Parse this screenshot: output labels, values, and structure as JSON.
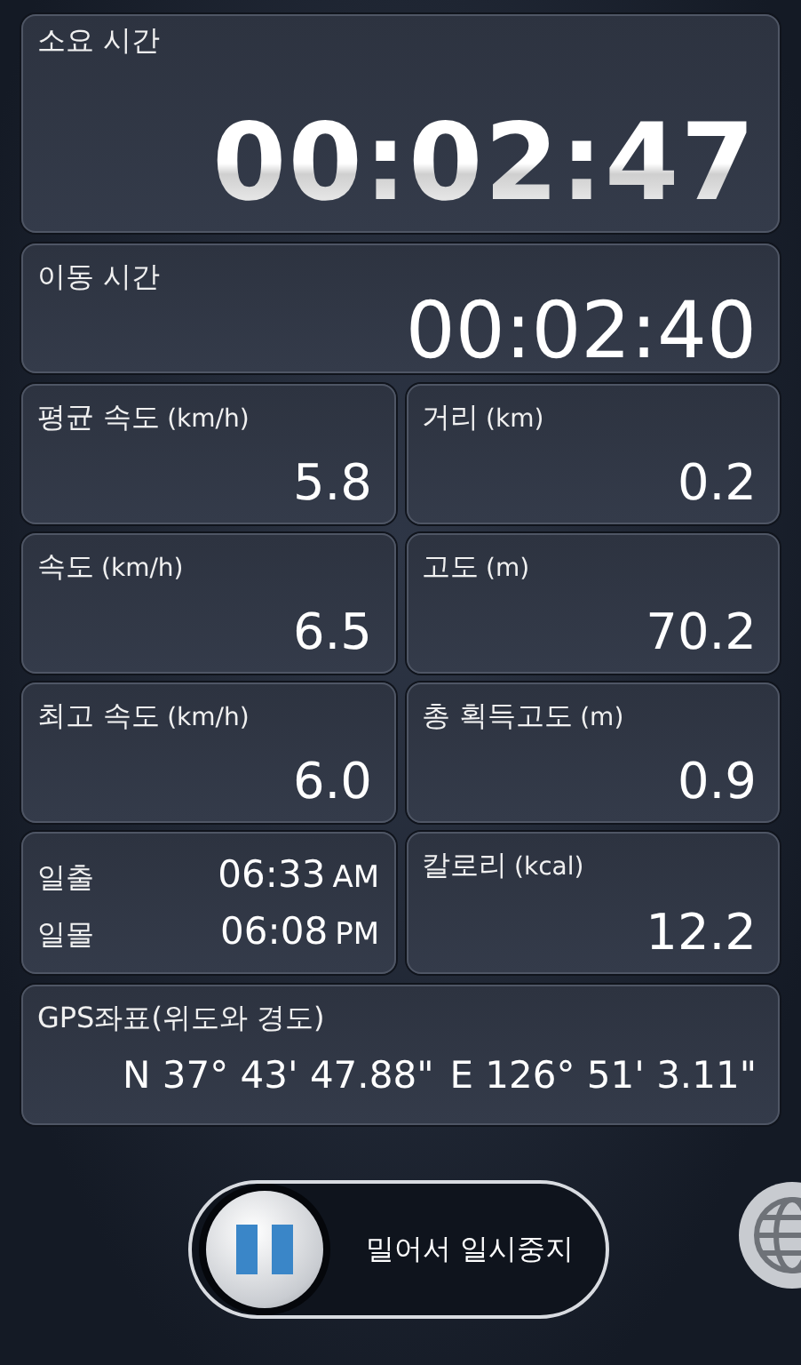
{
  "elapsed": {
    "label": "소요 시간",
    "value": "00:02:47"
  },
  "moving": {
    "label": "이동 시간",
    "value": "00:02:40"
  },
  "tiles": [
    {
      "kind": "stat",
      "label": "평균 속도",
      "unit": "(km/h)",
      "value": "5.8"
    },
    {
      "kind": "stat",
      "label": "거리",
      "unit": "(km)",
      "value": "0.2"
    },
    {
      "kind": "stat",
      "label": "속도",
      "unit": "(km/h)",
      "value": "6.5"
    },
    {
      "kind": "stat",
      "label": "고도",
      "unit": "(m)",
      "value": "70.2"
    },
    {
      "kind": "stat",
      "label": "최고 속도",
      "unit": "(km/h)",
      "value": "6.0"
    },
    {
      "kind": "stat",
      "label": "총 획득고도",
      "unit": "(m)",
      "value": "0.9"
    },
    {
      "kind": "sun",
      "rows": [
        {
          "label": "일출",
          "time": "06:33",
          "period": "AM"
        },
        {
          "label": "일몰",
          "time": "06:08",
          "period": "PM"
        }
      ]
    },
    {
      "kind": "stat",
      "label": "칼로리",
      "unit": "(kcal)",
      "value": "12.2"
    }
  ],
  "gps": {
    "label": "GPS좌표(위도와 경도)",
    "latitude": "N 37° 43' 47.88\"",
    "longitude": "E 126° 51' 3.11\""
  },
  "slider": {
    "label": "밀어서 일시중지"
  }
}
